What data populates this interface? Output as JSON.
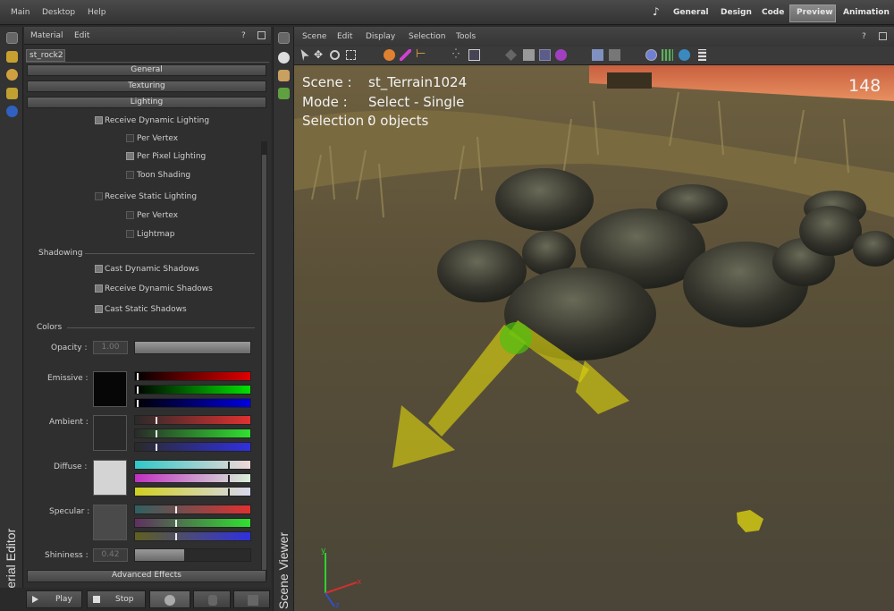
{
  "top_menu": [
    "Main",
    "Desktop",
    "Help"
  ],
  "top_right": {
    "music_icon": "♪",
    "tabs": [
      "General",
      "Design",
      "Code",
      "Preview",
      "Animation"
    ],
    "active": "Preview"
  },
  "material_panel": {
    "title": "Material Editor",
    "menus": [
      "Material",
      "Edit"
    ],
    "help": "?",
    "tab": "st_rock2",
    "sections": [
      "General",
      "Texturing",
      "Lighting"
    ],
    "lighting": [
      {
        "label": "Receive Dynamic Lighting",
        "checked": true
      },
      {
        "label": "Per Vertex",
        "checked": false
      },
      {
        "label": "Per Pixel Lighting",
        "checked": true
      },
      {
        "label": "Toon Shading",
        "checked": false
      },
      {
        "label": "Receive Static Lighting",
        "checked": false
      },
      {
        "label": "Per Vertex",
        "checked": false
      },
      {
        "label": "Lightmap",
        "checked": false
      }
    ],
    "shadowing_title": "Shadowing",
    "shadowing": [
      {
        "label": "Cast Dynamic Shadows",
        "checked": true
      },
      {
        "label": "Receive Dynamic Shadows",
        "checked": true
      },
      {
        "label": "Cast Static Shadows",
        "checked": true
      }
    ],
    "colors_title": "Colors",
    "opacity": {
      "label": "Opacity :",
      "value": "1.00"
    },
    "emissive": {
      "label": "Emissive :",
      "color": "#060606"
    },
    "ambient": {
      "label": "Ambient :",
      "color": "#2a2a2a"
    },
    "diffuse": {
      "label": "Diffuse :",
      "color": "#d4d4d4"
    },
    "specular": {
      "label": "Specular :",
      "color": "#4a4a4a"
    },
    "shininess": {
      "label": "Shininess :",
      "value": "0.42"
    },
    "advanced": "Advanced Effects",
    "play": "Play",
    "stop": "Stop"
  },
  "scene_panel": {
    "title": "Scene Viewer",
    "menus": [
      "Scene",
      "Edit",
      "Display",
      "Selection",
      "Tools"
    ],
    "help": "?",
    "overlay": {
      "scene_label": "Scene :",
      "scene_value": "st_Terrain1024",
      "mode_label": "Mode :",
      "mode_value": "Select - Single",
      "sel_label": "Selection :",
      "sel_value": "0 objects"
    },
    "fps": "148",
    "axis": {
      "y": "y",
      "x": "x",
      "z": "z"
    }
  }
}
